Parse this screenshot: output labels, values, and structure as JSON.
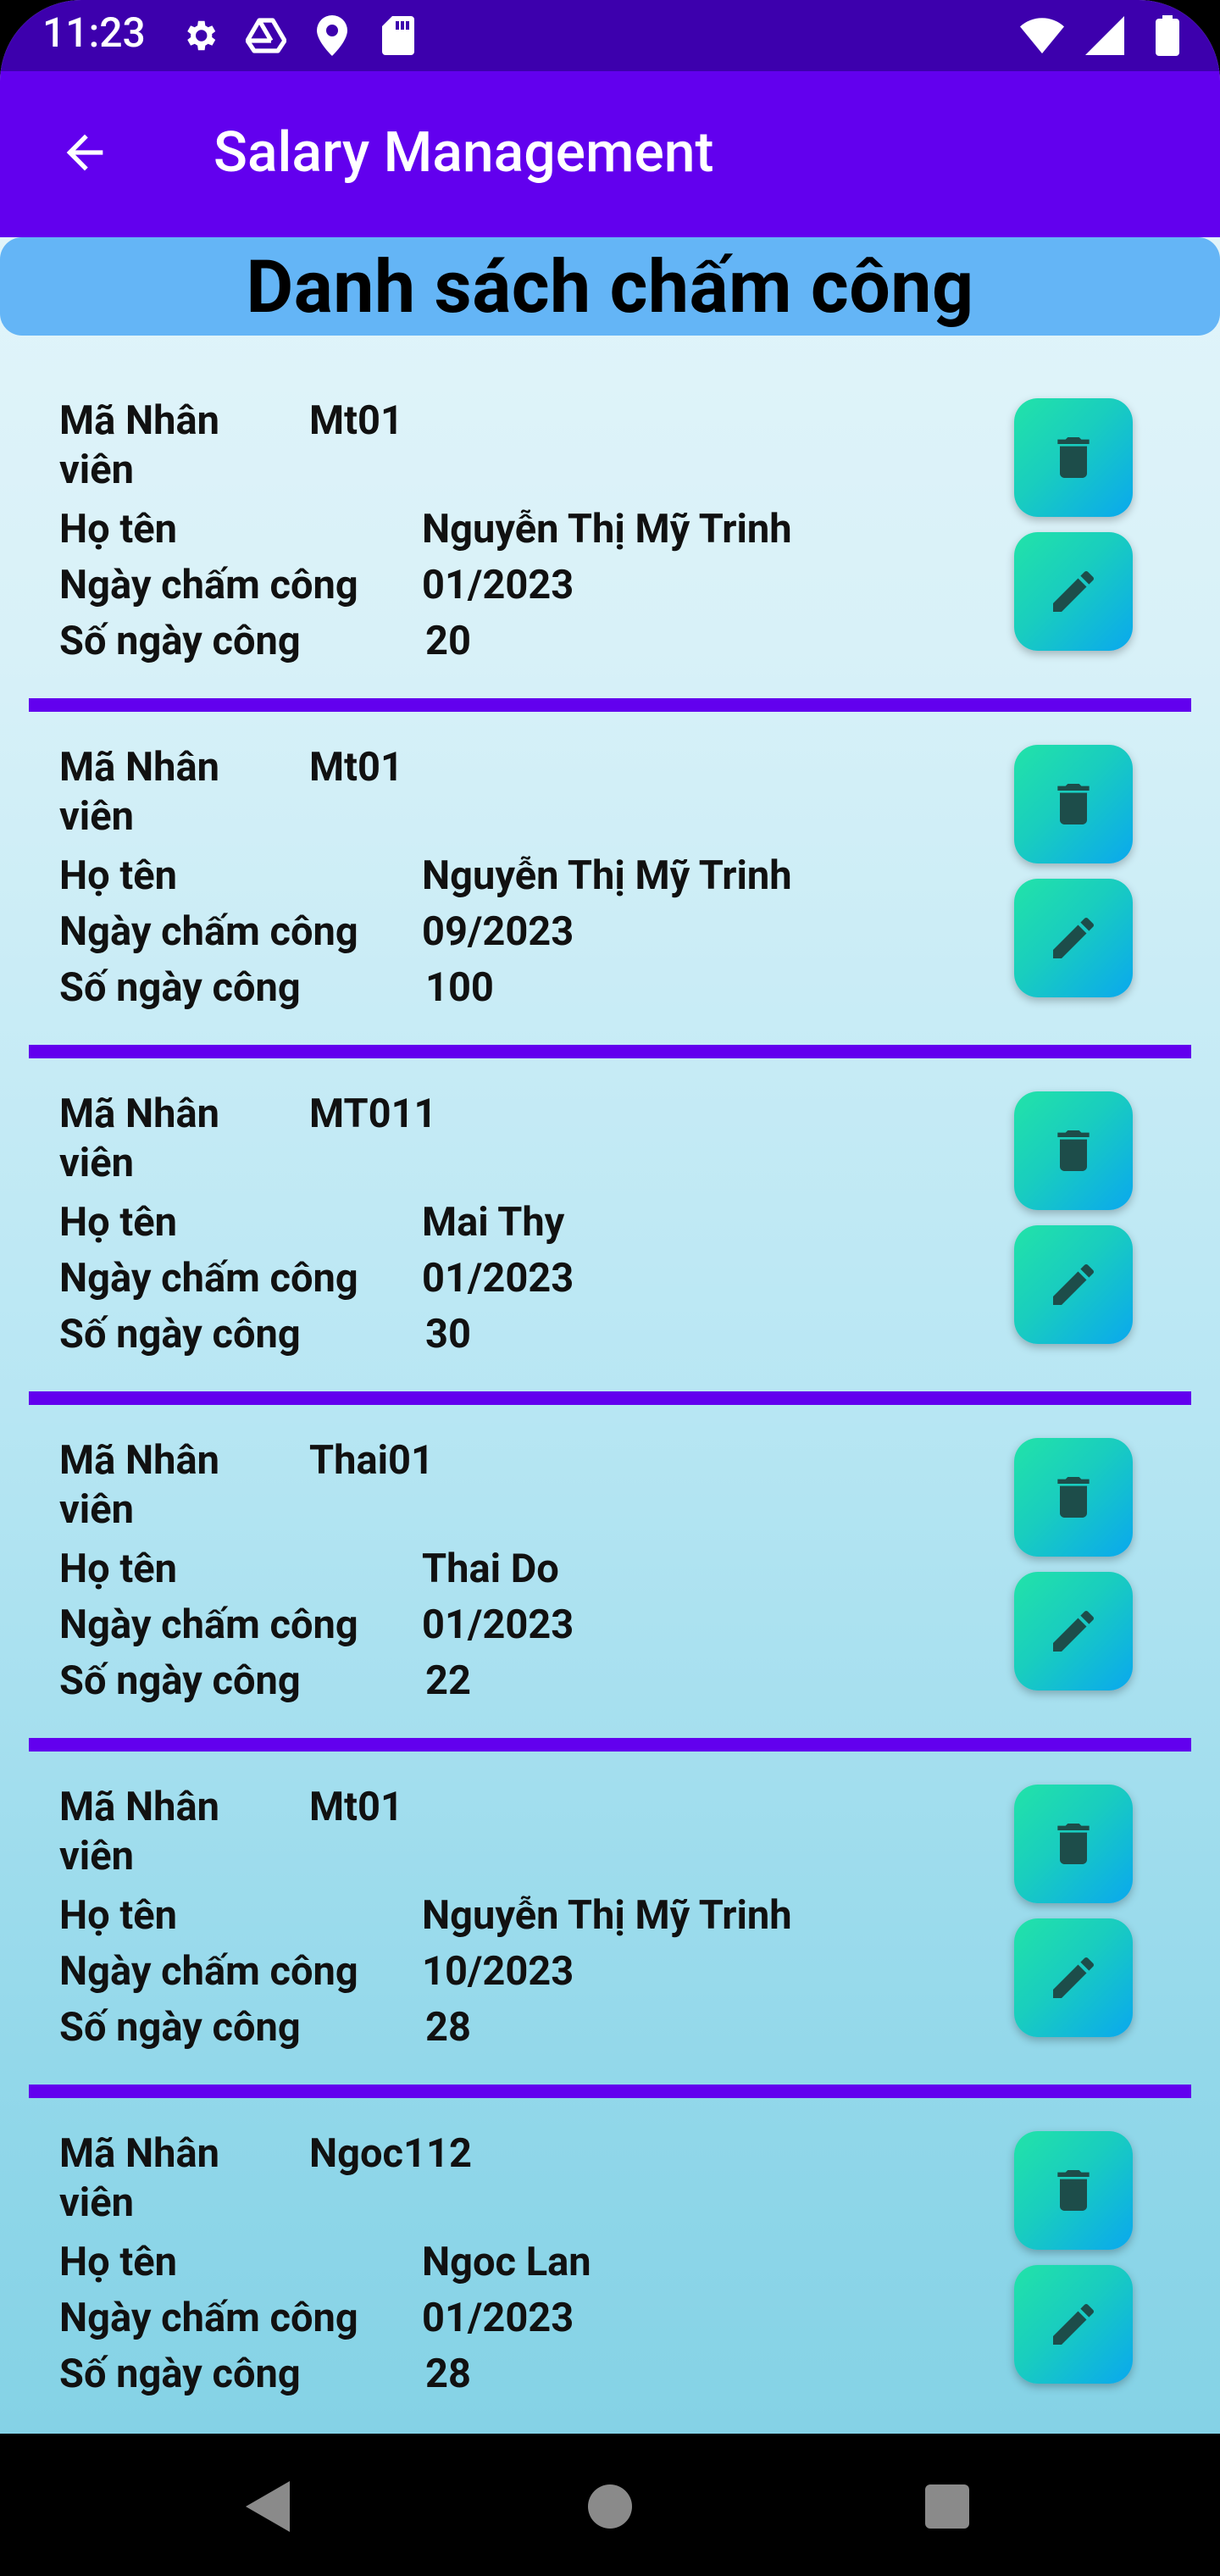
{
  "status_bar": {
    "time": "11:23",
    "left_icons": [
      "gear-icon",
      "drive-icon",
      "location-pin-icon",
      "sd-card-icon"
    ],
    "right_icons": [
      "wifi-icon",
      "signal-icon",
      "battery-icon"
    ]
  },
  "app_bar": {
    "title": "Salary Management",
    "back_icon": "arrow-back-icon"
  },
  "header": {
    "title": "Danh sách chấm công"
  },
  "labels": {
    "employee_id": "Mã Nhân viên",
    "full_name": "Họ tên",
    "date": "Ngày chấm công",
    "days": "Số ngày công"
  },
  "records": [
    {
      "employee_id": "Mt01",
      "full_name": "Nguyễn Thị Mỹ Trinh",
      "date": "01/2023",
      "days": "20"
    },
    {
      "employee_id": "Mt01",
      "full_name": "Nguyễn Thị Mỹ Trinh",
      "date": "09/2023",
      "days": "100"
    },
    {
      "employee_id": "MT011",
      "full_name": "Mai Thy",
      "date": "01/2023",
      "days": "30"
    },
    {
      "employee_id": "Thai01",
      "full_name": "Thai Do",
      "date": "01/2023",
      "days": "22"
    },
    {
      "employee_id": "Mt01",
      "full_name": "Nguyễn Thị Mỹ Trinh",
      "date": "10/2023",
      "days": "28"
    },
    {
      "employee_id": "Ngoc112",
      "full_name": "Ngoc Lan",
      "date": "01/2023",
      "days": "28"
    }
  ],
  "colors": {
    "status_bar": "#3d00ad",
    "app_bar": "#6200ee",
    "banner": "#64b5f6",
    "divider": "#6200ee",
    "button_gradient_start": "#22e3a8",
    "button_gradient_end": "#0aa8ee"
  },
  "nav_bar": {
    "icons": [
      "back-triangle-icon",
      "home-circle-icon",
      "recents-square-icon"
    ]
  }
}
